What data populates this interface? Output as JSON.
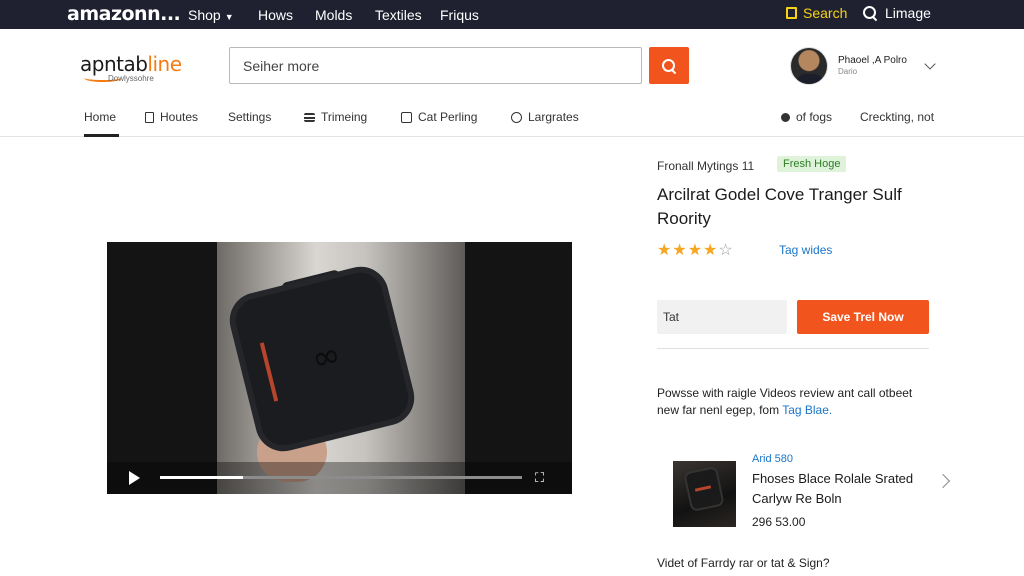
{
  "topbar": {
    "brand": "amazonn...",
    "nav": [
      "Shop",
      "Hows",
      "Molds",
      "Textiles",
      "Friqus"
    ],
    "search_label": "Search",
    "image_label": "Limage",
    "bg_color": "#1f2130",
    "accent_color": "#f5d417"
  },
  "header": {
    "logo_name": "apntabline",
    "logo_highlight": "line",
    "logo_sub": "Dowlyssohre",
    "search_placeholder": "Seiher more",
    "search_button_icon": "search-icon",
    "user_name": "Phaoel ,A Polro",
    "user_sub": "Dario"
  },
  "tabs": [
    {
      "label": "Home",
      "icon": ""
    },
    {
      "label": "Houtes",
      "icon": "route-icon"
    },
    {
      "label": "Settings",
      "icon": ""
    },
    {
      "label": "Trimeing",
      "icon": "list-icon"
    },
    {
      "label": "Cat Perling",
      "icon": "calendar-icon"
    },
    {
      "label": "Largrates",
      "icon": "refresh-icon"
    },
    {
      "label": "of fogs",
      "icon": "fog-icon"
    },
    {
      "label": "Creckting, not",
      "icon": ""
    }
  ],
  "video": {
    "progress": 0.23
  },
  "product": {
    "crumb": "Fronall Mytings 11",
    "badge": "Fresh Hoge",
    "title": "Arcilrat Godel Cove Tranger Sulf Roority",
    "rating": 4,
    "rating_max": 5,
    "rating_link": "Tag wides",
    "qty_value": "Tat",
    "cta_label": "Save Trel Now",
    "cta_color": "#f2541d",
    "description": "Powsse with raigle Videos review ant call otbeet new far nenl egep, fom",
    "description_link": "Tag Blae."
  },
  "recommendation": {
    "tag": "Arid 580",
    "title": "Fhoses Blace Rolale Srated Carlyw Re Boln",
    "price": "296 53.00"
  },
  "bottom_question": "Videt of Farrdy rar or tat & Sign?"
}
